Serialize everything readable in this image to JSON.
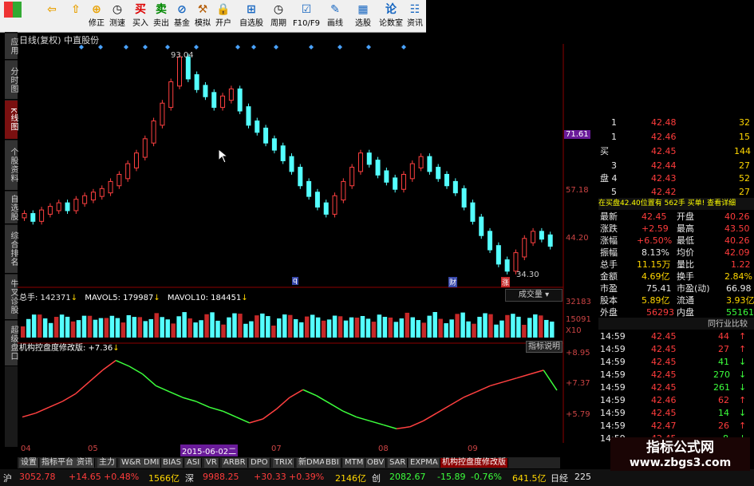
{
  "toolbar": {
    "buttons": [
      {
        "icon": "☐",
        "label": ""
      },
      {
        "icon": "⇦",
        "label": ""
      },
      {
        "icon": "⇧",
        "label": ""
      },
      {
        "icon": "⊕",
        "label": "修正"
      },
      {
        "icon": "◷",
        "label": "测速"
      },
      {
        "icon": "买",
        "label": "买入"
      },
      {
        "icon": "卖",
        "label": "卖出"
      },
      {
        "icon": "⊘",
        "label": "基金"
      },
      {
        "icon": "⚒",
        "label": "模拟"
      },
      {
        "icon": "🔒",
        "label": "开户"
      },
      {
        "icon": "⊞",
        "label": "自选股"
      },
      {
        "icon": "◷",
        "label": "周期"
      },
      {
        "icon": "☑",
        "label": "F10/F9"
      },
      {
        "icon": "✎",
        "label": "画线"
      },
      {
        "icon": "▦",
        "label": "选股"
      },
      {
        "icon": "论",
        "label": "论数室"
      },
      {
        "icon": "☷",
        "label": "资讯"
      }
    ]
  },
  "left_tabs": [
    "应用",
    "分时图",
    "K线图",
    "个股资料",
    "自选股",
    "综合排名",
    "牛叉诊股",
    "超级盘口"
  ],
  "chart_header": {
    "title": "日线(复权) 中直股份"
  },
  "price_axis": [
    "71.61",
    "57.18",
    "44.20"
  ],
  "price_annotations": {
    "high": "93.04",
    "low": "34.30"
  },
  "volume_header": {
    "total_label": "总手: 142371",
    "mavol5": "MAVOL5: 179987",
    "mavol10": "MAVOL10: 184451"
  },
  "volume_axis": [
    "32183",
    "15091",
    "X10"
  ],
  "volume_dropdown": "成交量",
  "indicator_header": {
    "name": "机构控盘度修改版: +7.36"
  },
  "indicator_axis": [
    "+8.95",
    "+7.37",
    "+5.79"
  ],
  "indicator_button": "指标说明",
  "x_axis": [
    "04",
    "05",
    "2015-06-02二",
    "07",
    "08",
    "09"
  ],
  "chart_data": {
    "type": "line",
    "title": "日线(复权) 中直股份",
    "series": [
      {
        "name": "price",
        "values": [
          49,
          48,
          50,
          51,
          52,
          51,
          53,
          54,
          55,
          56,
          58,
          60,
          63,
          66,
          70,
          75,
          80,
          86,
          93,
          88,
          85,
          83,
          80,
          82,
          84,
          79,
          75,
          73,
          70,
          68,
          65,
          62,
          58,
          55,
          52,
          50,
          54,
          58,
          62,
          66,
          64,
          61,
          59,
          57,
          60,
          63,
          65,
          62,
          60,
          58,
          56,
          52,
          48,
          44,
          40,
          36,
          34,
          38,
          42,
          44,
          43,
          41
        ]
      },
      {
        "name": "indicator",
        "values": [
          6.0,
          6.2,
          6.5,
          6.8,
          7.2,
          7.8,
          8.4,
          8.9,
          8.6,
          8.2,
          7.6,
          7.3,
          7.0,
          6.8,
          6.5,
          6.3,
          6.0,
          5.7,
          5.9,
          6.4,
          7.0,
          7.4,
          7.1,
          6.7,
          6.3,
          6.0,
          5.8,
          5.6,
          5.4,
          5.5,
          5.8,
          6.2,
          6.6,
          7.0,
          7.3,
          7.6,
          7.8,
          8.0,
          8.2,
          8.4,
          7.37
        ]
      }
    ],
    "ylim": [
      30,
      95
    ]
  },
  "right_panel": {
    "sell_rows": [
      {
        "n": "1",
        "p": "42.48",
        "v": "32"
      },
      {
        "n": "1",
        "p": "42.46",
        "v": "15"
      },
      {
        "n": "买",
        "p": "42.45",
        "v": "144"
      },
      {
        "n": "3",
        "p": "42.44",
        "v": "27"
      },
      {
        "n": "盘 4",
        "p": "42.43",
        "v": "52"
      },
      {
        "n": "5",
        "p": "42.42",
        "v": "27"
      }
    ],
    "buy_banner": "在买盘42.40位置有  562手  买单! 查看详细",
    "stats": [
      [
        "最新",
        "42.45",
        "开盘",
        "40.26"
      ],
      [
        "涨跌",
        "+2.59",
        "最高",
        "43.50"
      ],
      [
        "涨幅",
        "+6.50%",
        "最低",
        "40.26"
      ],
      [
        "振幅",
        "8.13%",
        "均价",
        "42.09"
      ],
      [
        "总手",
        "11.15万",
        "量比",
        "1.22"
      ],
      [
        "金额",
        "4.69亿",
        "换手",
        "2.84%"
      ],
      [
        "市盈",
        "75.41",
        "市盈(动)",
        "66.98"
      ],
      [
        "股本",
        "5.89亿",
        "流通",
        "3.93亿"
      ],
      [
        "外盘",
        "56293",
        "内盘",
        "55161"
      ]
    ],
    "compare_label": "同行业比较",
    "ticks": [
      [
        "14:59",
        "42.45",
        "44"
      ],
      [
        "14:59",
        "42.45",
        "27"
      ],
      [
        "14:59",
        "42.45",
        "41"
      ],
      [
        "14:59",
        "42.45",
        "270"
      ],
      [
        "14:59",
        "42.45",
        "261"
      ],
      [
        "14:59",
        "42.46",
        "62"
      ],
      [
        "14:59",
        "42.45",
        "14"
      ],
      [
        "14:59",
        "42.47",
        "26"
      ],
      [
        "14:59",
        "42.45",
        "8"
      ]
    ]
  },
  "tabbar": [
    "设置",
    "指标平台",
    "资讯",
    "主力",
    "W&R",
    "DMI",
    "BIAS",
    "ASI",
    "VR",
    "ARBR",
    "DPO",
    "TRIX",
    "新DMA",
    "BBI",
    "MTM",
    "OBV",
    "SAR",
    "EXPMA",
    "机构控盘度修改版"
  ],
  "statusbar": {
    "items": [
      "沪",
      "3052.78",
      "+14.65",
      "+0.48%",
      "1566亿",
      "深",
      "9988.25",
      "+30.33",
      "+0.39%",
      "2146亿",
      "创",
      "2082.67",
      "-15.89",
      "-0.76%",
      "641.5亿",
      "日经",
      "225"
    ]
  },
  "watermark": {
    "title": "指标公式网",
    "url": "www.zbgs3.com"
  }
}
